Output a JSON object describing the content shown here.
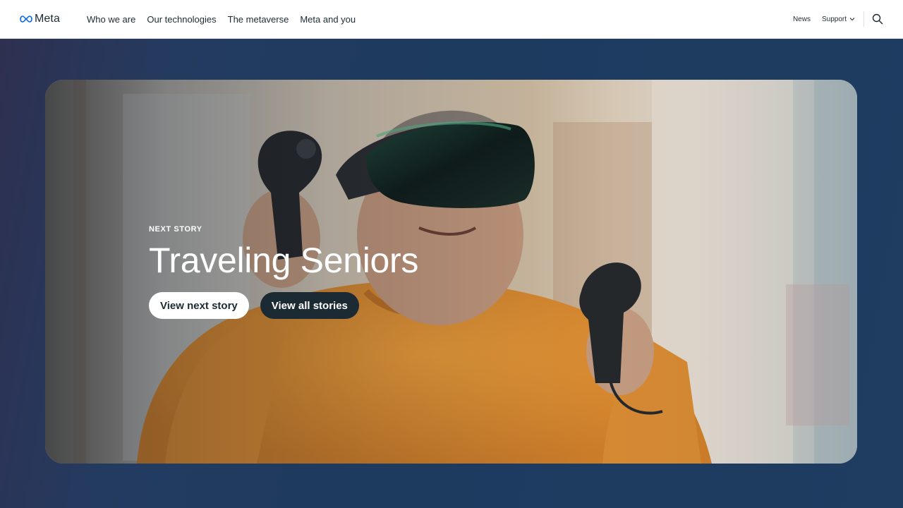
{
  "header": {
    "logo_text": "Meta",
    "nav": [
      {
        "label": "Who we are"
      },
      {
        "label": "Our technologies"
      },
      {
        "label": "The metaverse"
      },
      {
        "label": "Meta and you"
      }
    ],
    "news_label": "News",
    "support_label": "Support",
    "icons": {
      "logo": "meta-infinity-logo",
      "support": "chevron-down-icon",
      "search": "search-icon"
    }
  },
  "hero": {
    "eyebrow": "NEXT STORY",
    "title": "Traveling Seniors",
    "primary_button": "View next story",
    "secondary_button": "View all stories",
    "image_description_icon": "photo"
  },
  "colors": {
    "brand_text": "#1c2b33",
    "meta_blue": "#0668e1",
    "page_background": "#1d3a5f",
    "button_dark": "#1c2b33",
    "button_light": "#ffffff"
  }
}
